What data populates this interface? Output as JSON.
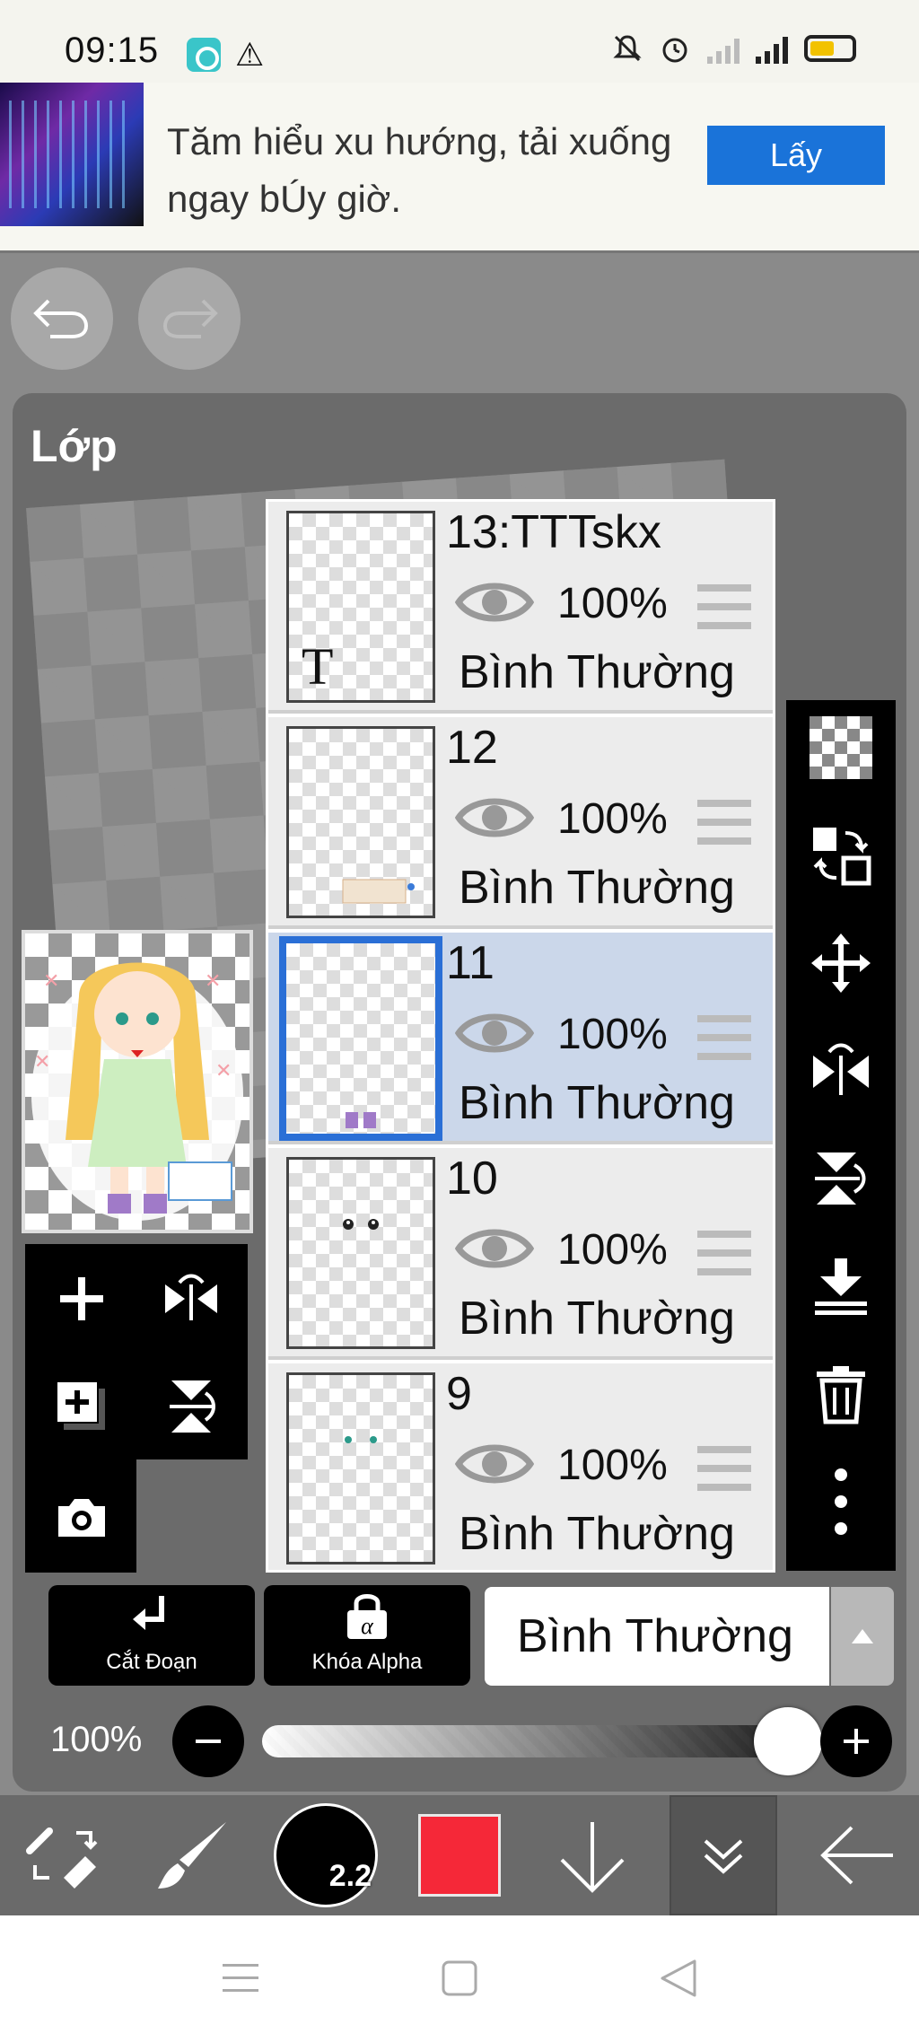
{
  "status_bar": {
    "time": "09:15",
    "icons": [
      "app-notification-icon",
      "warning-icon",
      "mute-icon",
      "alarm-icon",
      "signal-icon",
      "4g-signal-icon",
      "battery-icon"
    ],
    "network": "4G"
  },
  "ad": {
    "text": "Tăm hiểu xu hướng, tải xuống ngay bÚy giờ.",
    "button_label": "Lấy"
  },
  "panel": {
    "title": "Lớp"
  },
  "layers": [
    {
      "name": "13:TTTskx",
      "opacity": "100%",
      "mode": "Bình Thường",
      "selected": false,
      "thumb_text": "T"
    },
    {
      "name": "12",
      "opacity": "100%",
      "mode": "Bình Thường",
      "selected": false
    },
    {
      "name": "11",
      "opacity": "100%",
      "mode": "Bình Thường",
      "selected": true
    },
    {
      "name": "10",
      "opacity": "100%",
      "mode": "Bình Thường",
      "selected": false
    },
    {
      "name": "9",
      "opacity": "100%",
      "mode": "Bình Thường",
      "selected": false
    }
  ],
  "controls": {
    "clip_label": "Cắt Đoạn",
    "alpha_lock_label": "Khóa Alpha",
    "blend_mode": "Bình Thường",
    "opacity_label": "100%",
    "opacity_value": 1.0
  },
  "toolbar": {
    "brush_size": "2.2",
    "color": "#f52838"
  },
  "colors": {
    "selection_blue": "#2a6fd6",
    "selected_row": "#cbd7ea",
    "ad_button": "#1a73d9"
  }
}
